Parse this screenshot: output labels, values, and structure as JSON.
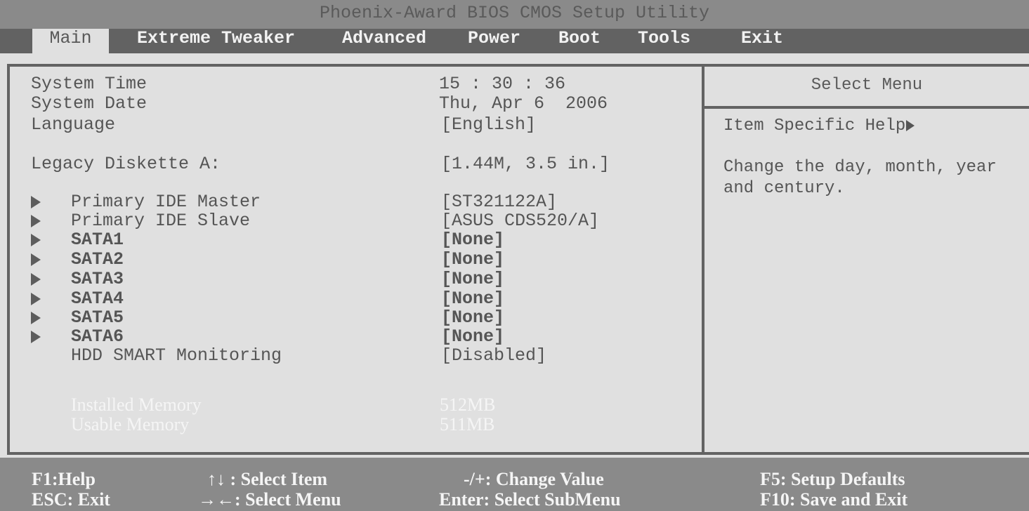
{
  "title": "Phoenix-Award BIOS CMOS Setup Utility",
  "menu": {
    "tabs": [
      {
        "label": "Main",
        "active": true
      },
      {
        "label": "Extreme Tweaker",
        "active": false
      },
      {
        "label": "Advanced",
        "active": false
      },
      {
        "label": "Power",
        "active": false
      },
      {
        "label": "Boot",
        "active": false
      },
      {
        "label": "Tools",
        "active": false
      },
      {
        "label": "Exit",
        "active": false
      }
    ]
  },
  "main": {
    "items": [
      {
        "label": "System Time",
        "value": "15 : 30 : 36"
      },
      {
        "label": "System Date",
        "value": "Thu, Apr 6  2006"
      },
      {
        "label": "Language",
        "value": "[English]"
      },
      {
        "label": "Legacy Diskette A:",
        "value": "[1.44M, 3.5 in.]"
      },
      {
        "label": "Primary IDE Master",
        "value": "[ST321122A]",
        "submenu": true
      },
      {
        "label": "Primary IDE Slave",
        "value": "[ASUS CDS520/A]",
        "submenu": true
      },
      {
        "label": "SATA1",
        "value": "[None]",
        "submenu": true
      },
      {
        "label": "SATA2",
        "value": "[None]",
        "submenu": true
      },
      {
        "label": "SATA3",
        "value": "[None]",
        "submenu": true
      },
      {
        "label": "SATA4",
        "value": "[None]",
        "submenu": true
      },
      {
        "label": "SATA5",
        "value": "[None]",
        "submenu": true
      },
      {
        "label": "SATA6",
        "value": "[None]",
        "submenu": true
      },
      {
        "label": "HDD SMART Monitoring",
        "value": "[Disabled]"
      }
    ],
    "info": [
      {
        "label": "Installed Memory",
        "value": "512MB"
      },
      {
        "label": "Usable Memory",
        "value": "511MB"
      }
    ]
  },
  "help": {
    "title": "Select Menu",
    "label": "Item Specific Help",
    "text": "Change the day, month, year and century."
  },
  "footer": {
    "keys": [
      "F1:Help",
      "ESC: Exit",
      "↑↓ : Select Item",
      "→←: Select Menu",
      "-/+: Change Value",
      "Enter: Select SubMenu",
      "F5: Setup Defaults",
      "F10: Save and Exit"
    ]
  }
}
